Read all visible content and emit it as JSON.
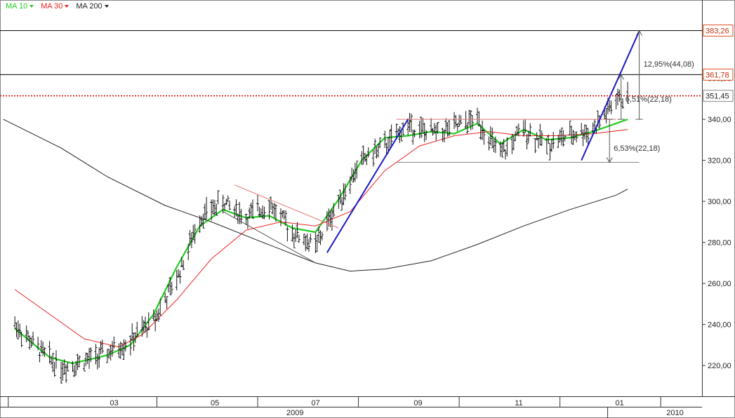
{
  "legend": [
    {
      "label": "MA 10",
      "color": "#22cc22"
    },
    {
      "label": "MA 30",
      "color": "#ee2222"
    },
    {
      "label": "MA 200",
      "color": "#222222"
    }
  ],
  "chart_data": {
    "type": "ohlc",
    "title": "",
    "xlabel": "",
    "ylabel": "",
    "ylim": [
      205,
      392
    ],
    "grid": false,
    "y_ticks": [
      220,
      240,
      260,
      280,
      300,
      320,
      340,
      360
    ],
    "y_tick_labels": [
      "220,00",
      "240,00",
      "260,00",
      "280,00",
      "300,00",
      "320,00",
      "340,00",
      "360,00"
    ],
    "x_month_labels": [
      "03",
      "05",
      "07",
      "09",
      "11",
      "01"
    ],
    "x_year_labels": [
      "2009",
      "2010"
    ],
    "price_series_close": [
      {
        "x": "2009-01-05",
        "y": 240
      },
      {
        "x": "2009-01-19",
        "y": 228
      },
      {
        "x": "2009-02-02",
        "y": 219
      },
      {
        "x": "2009-02-16",
        "y": 222
      },
      {
        "x": "2009-03-02",
        "y": 226
      },
      {
        "x": "2009-03-16",
        "y": 232
      },
      {
        "x": "2009-03-30",
        "y": 242
      },
      {
        "x": "2009-04-13",
        "y": 262
      },
      {
        "x": "2009-04-27",
        "y": 292
      },
      {
        "x": "2009-05-11",
        "y": 300
      },
      {
        "x": "2009-05-25",
        "y": 292
      },
      {
        "x": "2009-06-08",
        "y": 299
      },
      {
        "x": "2009-06-22",
        "y": 285
      },
      {
        "x": "2009-07-06",
        "y": 278
      },
      {
        "x": "2009-07-20",
        "y": 300
      },
      {
        "x": "2009-08-03",
        "y": 320
      },
      {
        "x": "2009-08-17",
        "y": 327
      },
      {
        "x": "2009-08-31",
        "y": 337
      },
      {
        "x": "2009-09-14",
        "y": 333
      },
      {
        "x": "2009-09-28",
        "y": 336
      },
      {
        "x": "2009-10-12",
        "y": 340
      },
      {
        "x": "2009-10-26",
        "y": 322
      },
      {
        "x": "2009-11-09",
        "y": 335
      },
      {
        "x": "2009-11-23",
        "y": 328
      },
      {
        "x": "2009-12-07",
        "y": 332
      },
      {
        "x": "2009-12-21",
        "y": 335
      },
      {
        "x": "2010-01-04",
        "y": 349
      },
      {
        "x": "2010-01-11",
        "y": 351
      }
    ],
    "series": [
      {
        "name": "MA 10",
        "color": "#22cc22",
        "values": [
          {
            "x": "2009-01-05",
            "y": 238
          },
          {
            "x": "2009-01-26",
            "y": 224
          },
          {
            "x": "2009-02-09",
            "y": 221
          },
          {
            "x": "2009-03-02",
            "y": 225
          },
          {
            "x": "2009-03-16",
            "y": 230
          },
          {
            "x": "2009-03-30",
            "y": 245
          },
          {
            "x": "2009-04-13",
            "y": 268
          },
          {
            "x": "2009-04-27",
            "y": 288
          },
          {
            "x": "2009-05-11",
            "y": 296
          },
          {
            "x": "2009-05-25",
            "y": 292
          },
          {
            "x": "2009-06-08",
            "y": 293
          },
          {
            "x": "2009-06-22",
            "y": 287
          },
          {
            "x": "2009-07-06",
            "y": 285
          },
          {
            "x": "2009-07-20",
            "y": 301
          },
          {
            "x": "2009-08-03",
            "y": 320
          },
          {
            "x": "2009-08-17",
            "y": 331
          },
          {
            "x": "2009-08-31",
            "y": 332
          },
          {
            "x": "2009-09-14",
            "y": 334
          },
          {
            "x": "2009-09-28",
            "y": 333
          },
          {
            "x": "2009-10-12",
            "y": 338
          },
          {
            "x": "2009-10-26",
            "y": 328
          },
          {
            "x": "2009-11-09",
            "y": 335
          },
          {
            "x": "2009-11-23",
            "y": 330
          },
          {
            "x": "2009-12-07",
            "y": 331
          },
          {
            "x": "2009-12-21",
            "y": 334
          },
          {
            "x": "2010-01-11",
            "y": 340
          }
        ]
      },
      {
        "name": "MA 30",
        "color": "#ee2222",
        "values": [
          {
            "x": "2009-01-05",
            "y": 257
          },
          {
            "x": "2009-01-26",
            "y": 245
          },
          {
            "x": "2009-02-16",
            "y": 233
          },
          {
            "x": "2009-03-09",
            "y": 229
          },
          {
            "x": "2009-03-23",
            "y": 235
          },
          {
            "x": "2009-04-13",
            "y": 252
          },
          {
            "x": "2009-05-04",
            "y": 272
          },
          {
            "x": "2009-05-25",
            "y": 286
          },
          {
            "x": "2009-06-15",
            "y": 290
          },
          {
            "x": "2009-07-06",
            "y": 288
          },
          {
            "x": "2009-07-27",
            "y": 295
          },
          {
            "x": "2009-08-17",
            "y": 315
          },
          {
            "x": "2009-09-07",
            "y": 327
          },
          {
            "x": "2009-09-28",
            "y": 332
          },
          {
            "x": "2009-10-19",
            "y": 334
          },
          {
            "x": "2009-11-09",
            "y": 332
          },
          {
            "x": "2009-11-30",
            "y": 332
          },
          {
            "x": "2009-12-21",
            "y": 333
          },
          {
            "x": "2010-01-11",
            "y": 335
          }
        ]
      },
      {
        "name": "MA 200",
        "color": "#222222",
        "values": [
          {
            "x": "2008-12-29",
            "y": 340
          },
          {
            "x": "2009-02-02",
            "y": 326
          },
          {
            "x": "2009-03-02",
            "y": 312
          },
          {
            "x": "2009-04-06",
            "y": 298
          },
          {
            "x": "2009-05-04",
            "y": 290
          },
          {
            "x": "2009-06-01",
            "y": 281
          },
          {
            "x": "2009-07-06",
            "y": 270
          },
          {
            "x": "2009-07-27",
            "y": 266
          },
          {
            "x": "2009-08-17",
            "y": 267
          },
          {
            "x": "2009-09-14",
            "y": 271
          },
          {
            "x": "2009-10-12",
            "y": 279
          },
          {
            "x": "2009-11-09",
            "y": 288
          },
          {
            "x": "2009-12-07",
            "y": 296
          },
          {
            "x": "2010-01-04",
            "y": 303
          },
          {
            "x": "2010-01-11",
            "y": 306
          }
        ]
      }
    ],
    "horizontal_levels": [
      {
        "value": 383.26,
        "label": "383,26",
        "style": "solid",
        "color": "#000000"
      },
      {
        "value": 361.78,
        "label": "361,78",
        "style": "solid",
        "color": "#000000"
      },
      {
        "value": 351.45,
        "label": "351,45",
        "style": "dotted",
        "color": "#cc0000"
      }
    ],
    "trendlines": [
      {
        "from": {
          "x": "2009-07-13",
          "y": 275
        },
        "to": {
          "x": "2009-08-31",
          "y": 340
        },
        "color": "#1a1ac8"
      },
      {
        "from": {
          "x": "2009-12-14",
          "y": 320
        },
        "to": {
          "x": "2010-01-18",
          "y": 383
        },
        "color": "#1a1ac8"
      },
      {
        "from": {
          "x": "2009-05-18",
          "y": 308
        },
        "to": {
          "x": "2009-07-20",
          "y": 287
        },
        "color": "#e67373"
      },
      {
        "from": {
          "x": "2009-05-11",
          "y": 295
        },
        "to": {
          "x": "2009-07-06",
          "y": 270
        },
        "color": "#555555"
      }
    ],
    "channel": [
      {
        "from": {
          "x": "2009-08-24",
          "y": 340
        },
        "to": {
          "x": "2010-01-04",
          "y": 340
        },
        "color": "#e67373"
      },
      {
        "from": {
          "x": "2009-08-24",
          "y": 319
        },
        "to": {
          "x": "2010-01-18",
          "y": 319
        },
        "color": "#888888"
      }
    ],
    "annotations": [
      {
        "text": "12,95%(44,08)",
        "color": "#333333"
      },
      {
        "text": "6,51%(22,18)",
        "color": "#333333"
      },
      {
        "text": "6,53%(22,18)",
        "color": "#333333"
      }
    ]
  }
}
